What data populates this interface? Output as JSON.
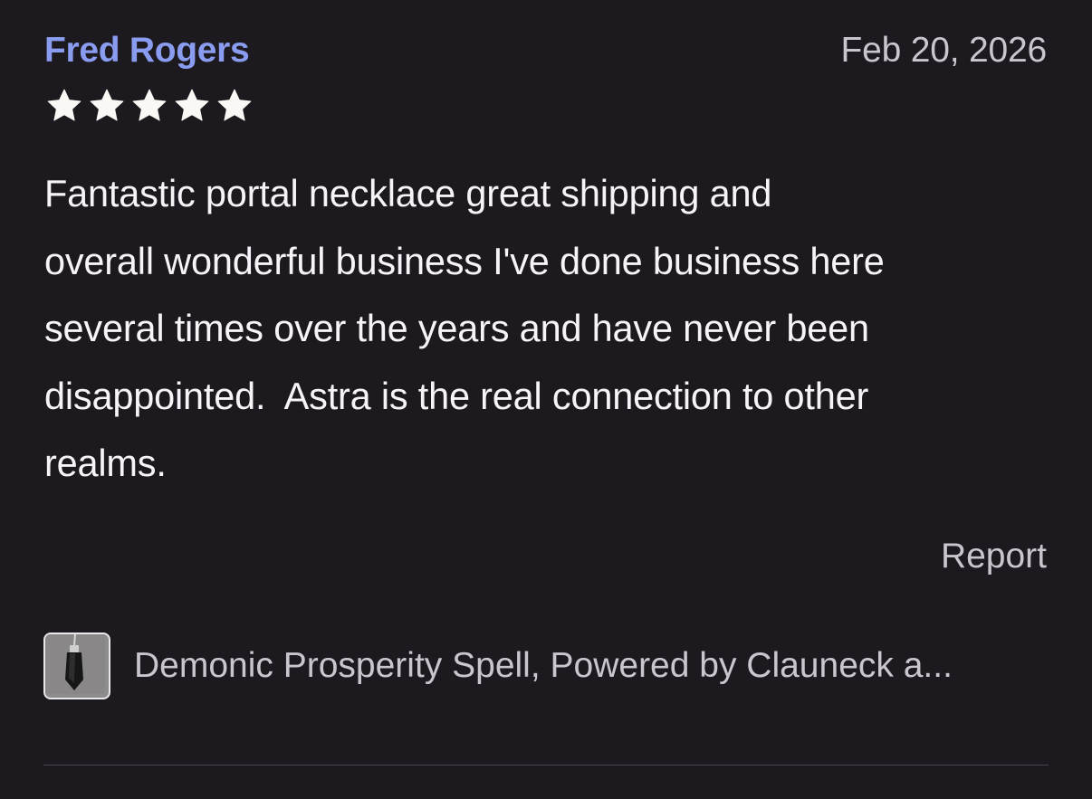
{
  "review": {
    "reviewer_name": "Fred Rogers",
    "date": "Feb 20, 2026",
    "rating": 5,
    "rating_max": 5,
    "body": "Fantastic portal necklace great shipping and\noverall wonderful business I've done business here\nseveral times over the years and have never been\ndisappointed.  Astra is the real connection to other\nrealms.",
    "report_label": "Report"
  },
  "product": {
    "title": "Demonic Prosperity Spell, Powered by Clauneck a...",
    "thumbnail_icon": "pendant-thumbnail"
  },
  "colors": {
    "background": "#1c1a1f",
    "name_accent": "#8a9cf0",
    "secondary_text": "#c9c6cd",
    "star": "#faf8f4"
  }
}
